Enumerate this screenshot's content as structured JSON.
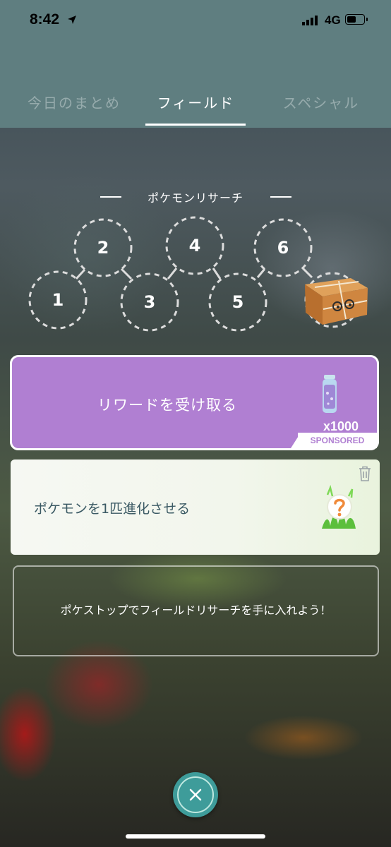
{
  "status_bar": {
    "time": "8:42",
    "network": "4G"
  },
  "tabs": [
    {
      "label": "今日のまとめ",
      "selected": false
    },
    {
      "label": "フィールド",
      "selected": true
    },
    {
      "label": "スペシャル",
      "selected": false
    }
  ],
  "research": {
    "title": "ポケモンリサーチ",
    "stamps": [
      "1",
      "2",
      "3",
      "4",
      "5",
      "6"
    ]
  },
  "reward": {
    "label": "リワードを受け取る",
    "quantity": "x1000",
    "badge": "SPONSORED",
    "color": "#b07fd2"
  },
  "task": {
    "label": "ポケモンを1匹進化させる"
  },
  "empty_slot": {
    "message": "ポケストップでフィールドリサーチを手に入れよう！"
  },
  "colors": {
    "header": "#5f7e80",
    "close_button": "#3e9c9a"
  }
}
